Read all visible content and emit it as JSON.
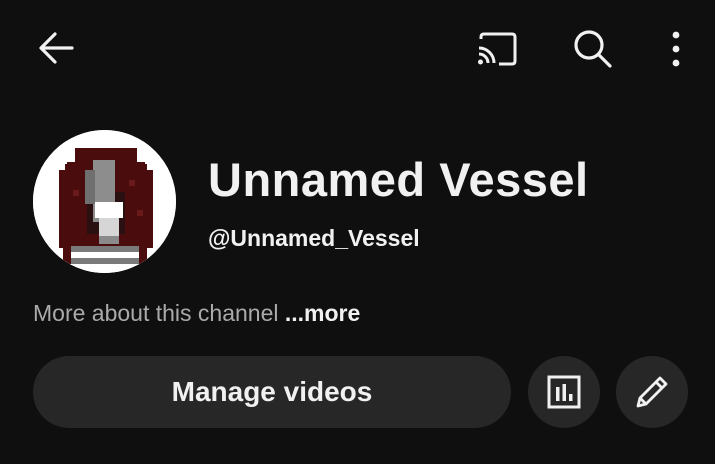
{
  "topbar": {
    "icons": [
      "back-arrow-icon",
      "cast-icon",
      "search-icon",
      "more-vert-icon"
    ]
  },
  "channel": {
    "name": "Unnamed Vessel",
    "handle": "@Unnamed_Vessel",
    "about_text": "More about this channel",
    "more_label": "...more"
  },
  "actions": {
    "manage_videos_label": "Manage videos",
    "icons": [
      "analytics-icon",
      "edit-pencil-icon"
    ]
  },
  "colors": {
    "background": "#0f0f0f",
    "button": "#272727",
    "text": "#f1f1f1",
    "secondary_text": "#aaaaaa",
    "avatar_hair": "#4a0c0c"
  }
}
